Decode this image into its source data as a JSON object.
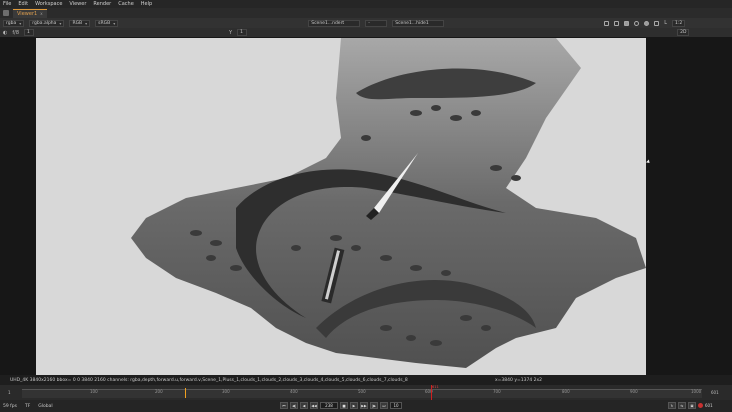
{
  "menubar": {
    "items": [
      "File",
      "Edit",
      "Workspace",
      "Viewer",
      "Render",
      "Cache",
      "Help"
    ]
  },
  "tabs": {
    "active_label": "Viewer1",
    "close_glyph": "x"
  },
  "toolbar": {
    "channels": "rgba",
    "alpha": "rgba.alpha",
    "colorspace_rgb": "RGB",
    "colorspace_srgb": "sRGB",
    "input_a": "Scene1...ndert",
    "blend": "-",
    "input_b": "Scene1...hide1",
    "zoom_label": "1:2",
    "lock_label": "L"
  },
  "toolbar2": {
    "frame_prefix": "f/8",
    "frame_value": "1",
    "y_label": "Y",
    "y_value": "1",
    "view_mode": "2D"
  },
  "info": {
    "format": "UHD_4K 3840x2160  bbox= 0 0 3840 2160 channels: rgba,depth,forward.u,forward.v,Scene_1,Pluss_1,clouds_1,clouds_2,clouds_3,clouds_4,clouds_5,clouds_6,clouds_7,clouds_8",
    "coords": "x=3840 y=1374 2x2"
  },
  "timeline": {
    "start": "1",
    "end": "601",
    "ticks": [
      "100",
      "200",
      "300",
      "400",
      "500",
      "600",
      "700",
      "800",
      "900",
      "1000"
    ],
    "current_frame_marker": "331",
    "red_marker": "611"
  },
  "playbar": {
    "fps": "59 fps",
    "tf": "TF",
    "global": "Global",
    "frame": "238",
    "step": "10",
    "out_frame": "601"
  },
  "colors": {
    "accent": "#e09a3a",
    "playhead": "#f0a020",
    "red_marker": "#d02020"
  }
}
